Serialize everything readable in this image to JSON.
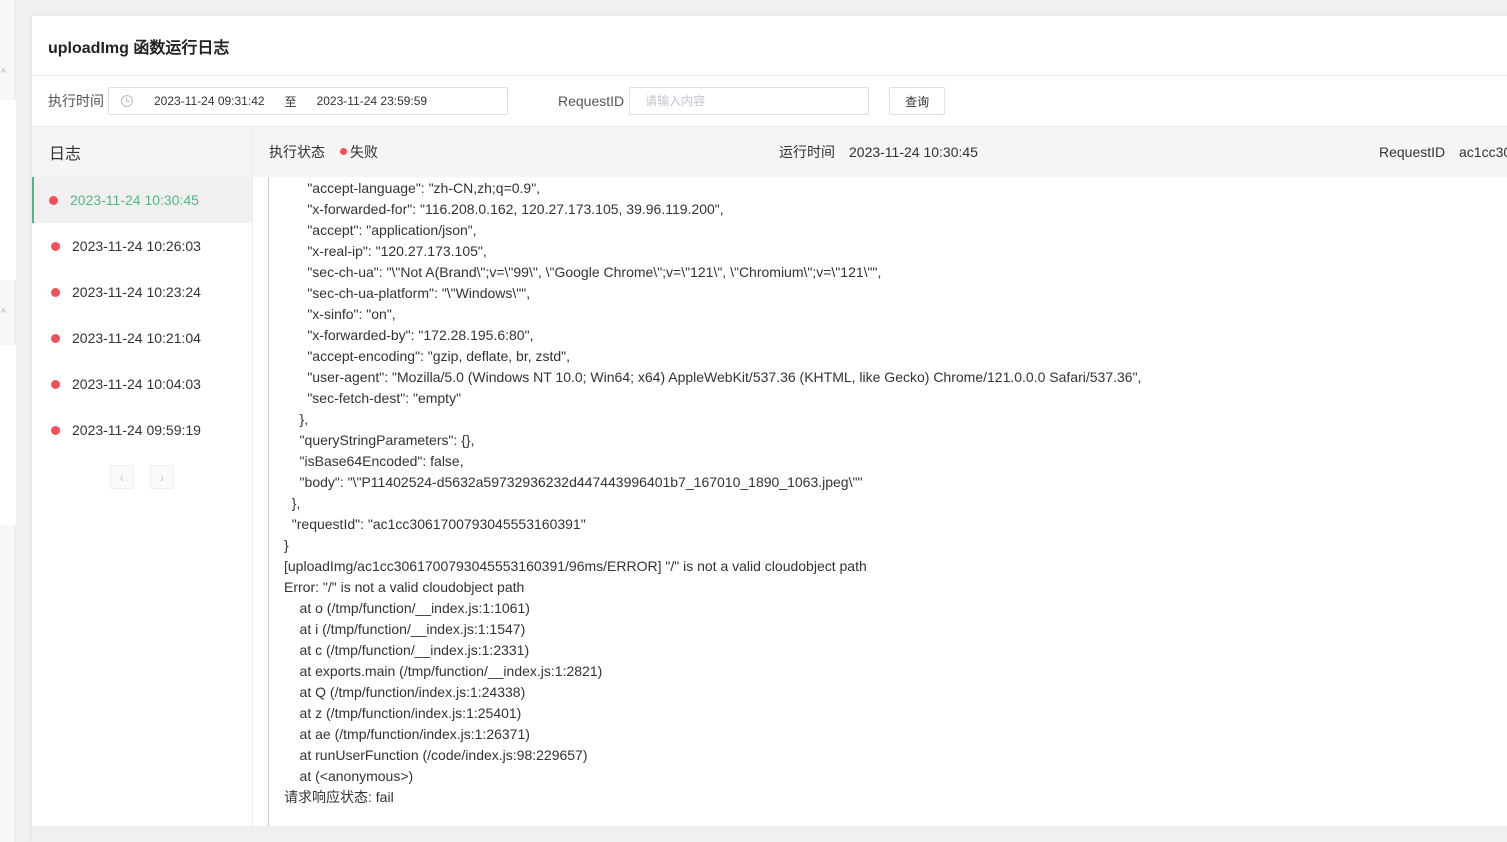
{
  "dialog": {
    "title": "uploadImg 函数运行日志"
  },
  "filter": {
    "exec_time_label": "执行时间",
    "date_start": "2023-11-24 09:31:42",
    "date_separator": "至",
    "date_end": "2023-11-24 23:59:59",
    "request_id_label": "RequestID",
    "request_id_placeholder": "请输入内容",
    "query_label": "查询"
  },
  "sidebar": {
    "title": "日志",
    "items": [
      {
        "time": "2023-11-24 10:30:45",
        "active": true
      },
      {
        "time": "2023-11-24 10:26:03"
      },
      {
        "time": "2023-11-24 10:23:24"
      },
      {
        "time": "2023-11-24 10:21:04"
      },
      {
        "time": "2023-11-24 10:04:03"
      },
      {
        "time": "2023-11-24 09:59:19"
      }
    ],
    "prev_icon": "‹",
    "next_icon": "›"
  },
  "detail": {
    "status_label": "执行状态",
    "status_value": "失败",
    "run_time_label": "运行时间",
    "run_time_value": "2023-11-24 10:30:45",
    "request_id_label": "RequestID",
    "request_id_value": "ac1cc30"
  },
  "log_lines": [
    "      \"accept-language\": \"zh-CN,zh;q=0.9\",",
    "      \"x-forwarded-for\": \"116.208.0.162, 120.27.173.105, 39.96.119.200\",",
    "      \"accept\": \"application/json\",",
    "      \"x-real-ip\": \"120.27.173.105\",",
    "      \"sec-ch-ua\": \"\\\"Not A(Brand\\\";v=\\\"99\\\", \\\"Google Chrome\\\";v=\\\"121\\\", \\\"Chromium\\\";v=\\\"121\\\"\",",
    "      \"sec-ch-ua-platform\": \"\\\"Windows\\\"\",",
    "      \"x-sinfo\": \"on\",",
    "      \"x-forwarded-by\": \"172.28.195.6:80\",",
    "      \"accept-encoding\": \"gzip, deflate, br, zstd\",",
    "      \"user-agent\": \"Mozilla/5.0 (Windows NT 10.0; Win64; x64) AppleWebKit/537.36 (KHTML, like Gecko) Chrome/121.0.0.0 Safari/537.36\",",
    "      \"sec-fetch-dest\": \"empty\"",
    "    },",
    "    \"queryStringParameters\": {},",
    "    \"isBase64Encoded\": false,",
    "    \"body\": \"\\\"P11402524-d5632a59732936232d447443996401b7_167010_1890_1063.jpeg\\\"\"",
    "  },",
    "  \"requestId\": \"ac1cc3061700793045553160391\"",
    "}",
    "[uploadImg/ac1cc3061700793045553160391/96ms/ERROR] \"/\" is not a valid cloudobject path",
    "Error: \"/\" is not a valid cloudobject path",
    "    at o (/tmp/function/__index.js:1:1061)",
    "    at i (/tmp/function/__index.js:1:1547)",
    "    at c (/tmp/function/__index.js:1:2331)",
    "    at exports.main (/tmp/function/__index.js:1:2821)",
    "    at Q (/tmp/function/index.js:1:24338)",
    "    at z (/tmp/function/index.js:1:25401)",
    "    at ae (/tmp/function/index.js:1:26371)",
    "    at runUserFunction (/code/index.js:98:229657)",
    "    at (<anonymous>)",
    "请求响应状态: fail"
  ],
  "colors": {
    "accent": "#52b783",
    "error": "#f0505a"
  }
}
